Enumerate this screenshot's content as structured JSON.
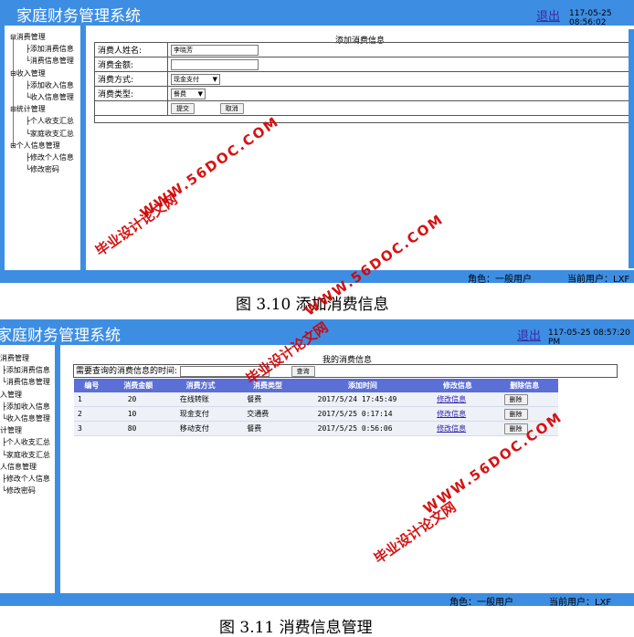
{
  "app_title": "家庭财务管理系统",
  "logout_label": "退出",
  "screen1": {
    "datetime": "117-05-25 08:56:02",
    "role": "角色：一般用户",
    "current_user": "当前用户：LXF",
    "form_title": "添加消费信息",
    "fields": {
      "name_label": "消费人姓名:",
      "name_value": "李晓芳",
      "amount_label": "消费金额:",
      "amount_value": "",
      "method_label": "消费方式:",
      "method_value": "现金支付",
      "type_label": "消费类型:",
      "type_value": "餐费"
    },
    "submit_label": "提交",
    "cancel_label": "取消"
  },
  "caption1": "图 3.10 添加消费信息",
  "screen2": {
    "datetime": "117-05-25 08:57:20 PM",
    "role": "角色：一般用户",
    "current_user": "当前用户：LXF",
    "list_title": "我的消费信息",
    "query_label": "需要查询的消费信息的时间:",
    "query_value": "",
    "query_button": "查询",
    "columns": [
      "编号",
      "消费金额",
      "消费方式",
      "消费类型",
      "添加时间",
      "修改信息",
      "删除信息"
    ],
    "rows": [
      {
        "id": "1",
        "amount": "20",
        "method": "在线转账",
        "type": "餐费",
        "time": "2017/5/24 17:45:49",
        "edit": "修改信息",
        "del": "删除"
      },
      {
        "id": "2",
        "amount": "10",
        "method": "现金支付",
        "type": "交通费",
        "time": "2017/5/25 0:17:14",
        "edit": "修改信息",
        "del": "删除"
      },
      {
        "id": "3",
        "amount": "80",
        "method": "移动支付",
        "type": "餐费",
        "time": "2017/5/25 0:56:06",
        "edit": "修改信息",
        "del": "删除"
      }
    ]
  },
  "caption2": "图 3.11 消费信息管理",
  "sidebar": {
    "groups": [
      {
        "label": "消费管理",
        "items": [
          "添加消费信息",
          "消费信息管理"
        ]
      },
      {
        "label": "收入管理",
        "items": [
          "添加收入信息",
          "收入信息管理"
        ]
      },
      {
        "label": "统计管理",
        "items": [
          "个人收支汇总",
          "家庭收支汇总"
        ]
      },
      {
        "label": "个人信息管理",
        "items": [
          "修改个人信息",
          "修改密码"
        ]
      }
    ],
    "screen2_groups": [
      {
        "label": "消费管理",
        "items": [
          "添加消费信息",
          "消费信息管理"
        ]
      },
      {
        "label": "入管理",
        "items": [
          "添加收入信息",
          "收入信息管理"
        ]
      },
      {
        "label": "计管理",
        "items": [
          "个人收支汇总",
          "家庭收支汇总"
        ]
      },
      {
        "label": "人信息管理",
        "items": [
          "修改个人信息",
          "修改密码"
        ]
      }
    ]
  },
  "watermarks": {
    "site": "WWW.56DOC.COM",
    "cn": "毕业设计论文网"
  },
  "colors": {
    "bar": "#3d8ee3",
    "header": "#5b6fd6",
    "watermark": "#d20000"
  }
}
